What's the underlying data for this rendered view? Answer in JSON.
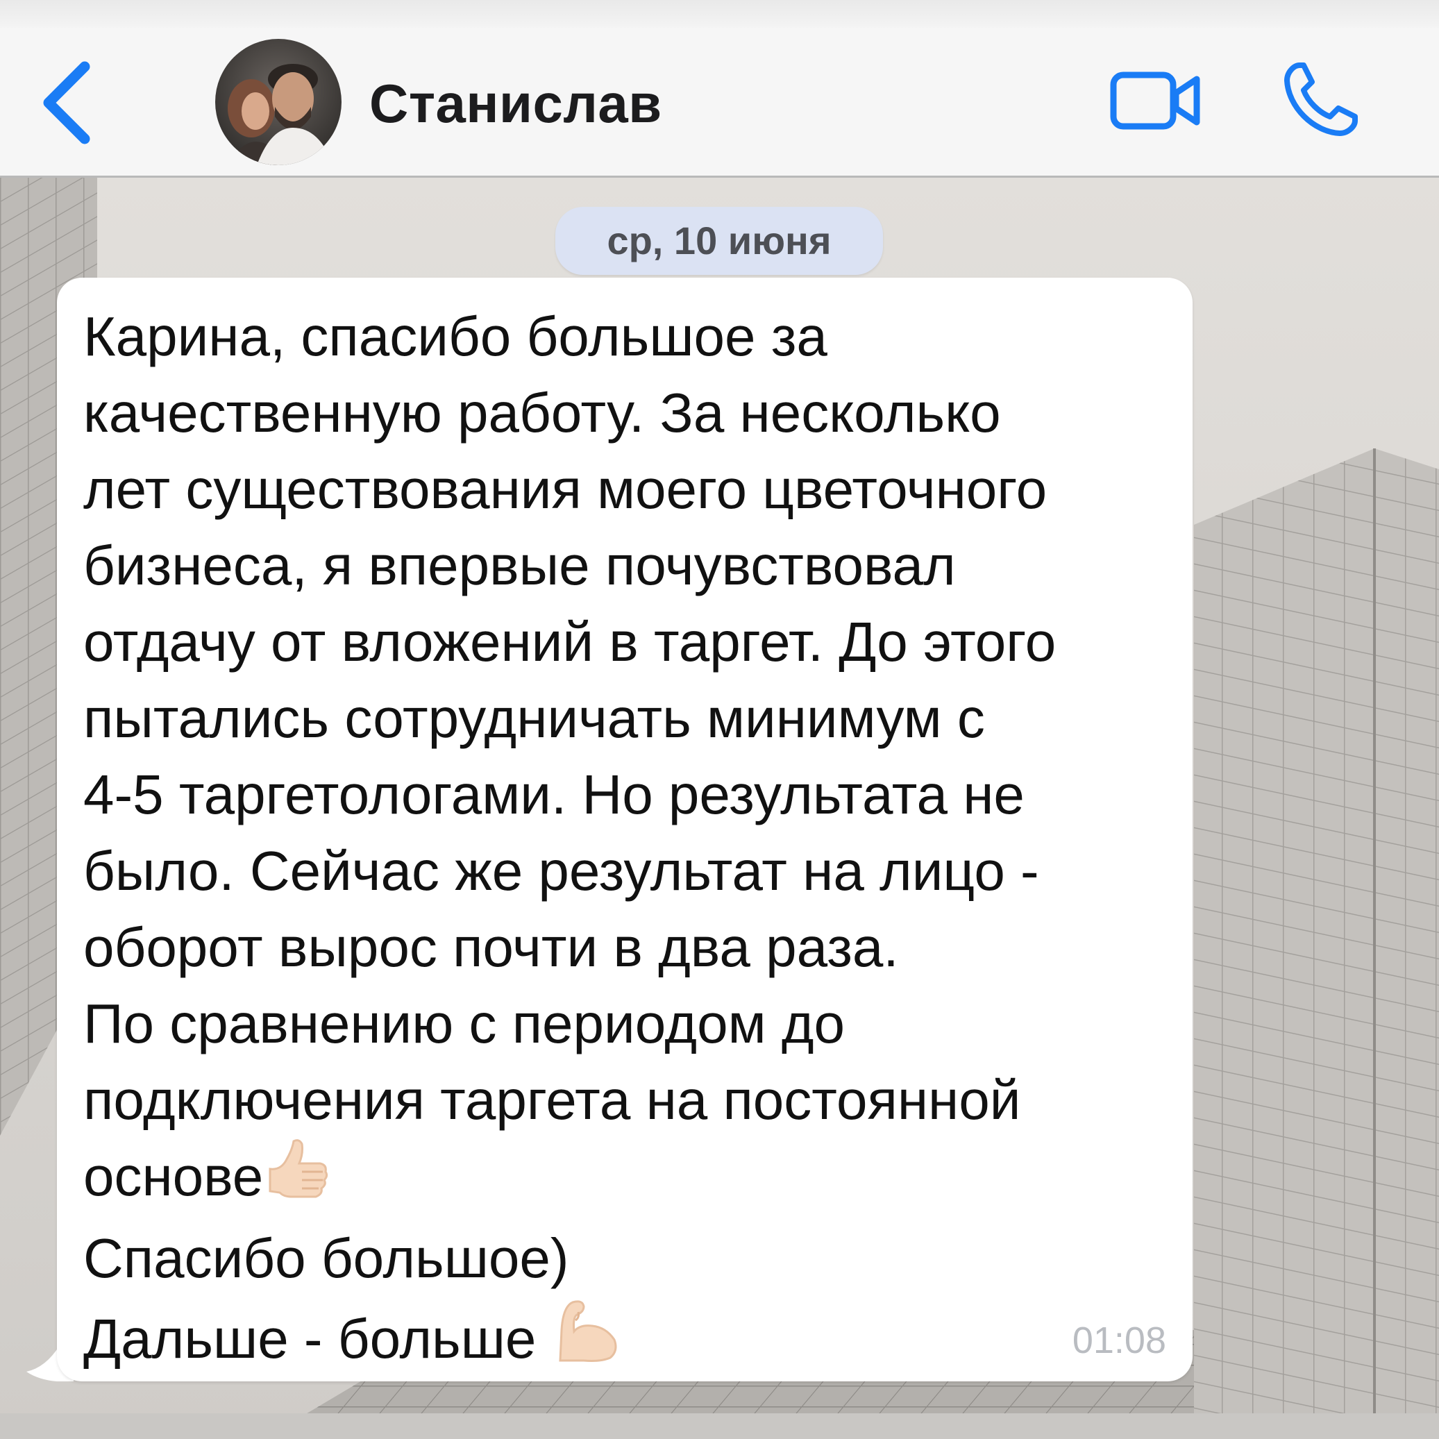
{
  "header": {
    "back_icon": "chevron-left-icon",
    "contact_name": "Станислав",
    "avatar_icon": "contact-avatar-photo",
    "video_call_icon": "video-camera-icon",
    "voice_call_icon": "phone-icon",
    "accent_color": "#1a7cf5"
  },
  "chat": {
    "date_label": "ср, 10 июня",
    "message": {
      "lines": [
        "Карина, спасибо большое за",
        "качественную работу. За несколько",
        "лет существования моего цветочного",
        "бизнеса, я впервые почувствовал",
        "отдачу от вложений в таргет. До этого",
        "пытались сотрудничать минимум с",
        "4-5 таргетологами. Но результата не",
        "было. Сейчас же результат на лицо -",
        "оборот вырос почти в два раза.",
        "По сравнению с периодом до",
        "подключения таргета на постоянной",
        "основе",
        "Спасибо большое)",
        "Дальше - больше "
      ],
      "emoji_after_line_12": "thumbs-up-icon",
      "emoji_after_line_14": "flexed-biceps-icon",
      "time": "01:08"
    }
  }
}
